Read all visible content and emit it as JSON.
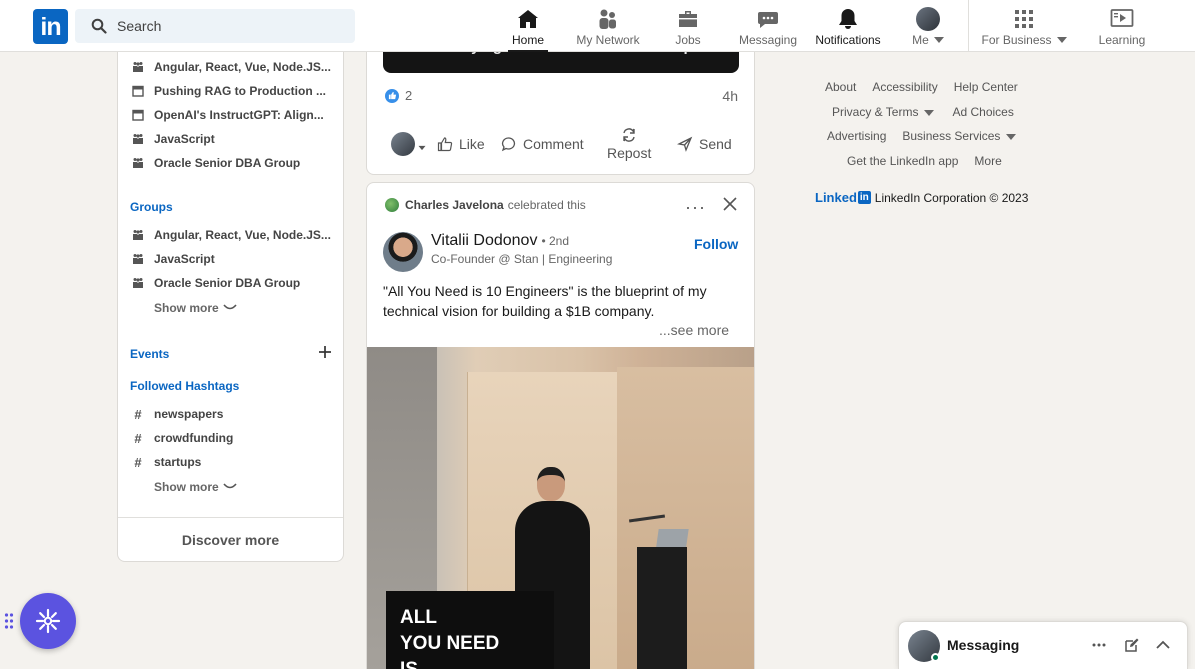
{
  "nav": {
    "logo_text": "in",
    "search_placeholder": "Search",
    "items": [
      {
        "label": "Home",
        "icon": "home-icon"
      },
      {
        "label": "My Network",
        "icon": "network-icon"
      },
      {
        "label": "Jobs",
        "icon": "briefcase-icon"
      },
      {
        "label": "Messaging",
        "icon": "chat-icon"
      },
      {
        "label": "Notifications",
        "icon": "bell-icon"
      },
      {
        "label": "Me",
        "icon": "avatar"
      },
      {
        "label": "For Business",
        "icon": "grid-icon"
      },
      {
        "label": "Learning",
        "icon": "play-icon"
      }
    ]
  },
  "sidebar": {
    "recent": [
      {
        "label": "Angular, React, Vue, Node.JS...",
        "icon": "group-icon"
      },
      {
        "label": "Pushing RAG to Production ...",
        "icon": "calendar-icon"
      },
      {
        "label": "OpenAI's InstructGPT: Align...",
        "icon": "calendar-icon"
      },
      {
        "label": "JavaScript",
        "icon": "group-icon"
      },
      {
        "label": "Oracle Senior DBA Group",
        "icon": "group-icon"
      }
    ],
    "groups_title": "Groups",
    "groups": [
      {
        "label": "Angular, React, Vue, Node.JS..."
      },
      {
        "label": "JavaScript"
      },
      {
        "label": "Oracle Senior DBA Group"
      }
    ],
    "show_more": "Show more",
    "events_title": "Events",
    "hashtags_title": "Followed Hashtags",
    "hashtags": [
      {
        "label": "newspapers"
      },
      {
        "label": "crowdfunding"
      },
      {
        "label": "startups"
      }
    ],
    "discover_more": "Discover more"
  },
  "post1": {
    "image_caption": "the Underlying Issues in Tech Leadership",
    "reaction_count": "2",
    "age": "4h",
    "actions": {
      "like": "Like",
      "comment": "Comment",
      "repost": "Repost",
      "send": "Send"
    }
  },
  "post2": {
    "celebrator": "Charles Javelona",
    "celebrated_text": "celebrated this",
    "author_name": "Vitalii Dodonov",
    "degree": "• 2nd",
    "author_headline": "Co-Founder @ Stan | Engineering",
    "follow_label": "Follow",
    "text": "\"All You Need is 10 Engineers\" is the blueprint of my technical vision for building a $1B company.",
    "see_more": "...see more",
    "image_overlay_text": "ALL\nYOU NEED\nIS"
  },
  "footer": {
    "links": [
      "About",
      "Accessibility",
      "Help Center",
      "Privacy & Terms",
      "Ad Choices",
      "Advertising",
      "Business Services",
      "Get the LinkedIn app",
      "More"
    ],
    "brand_word": "Linked",
    "brand_box": "in",
    "copyright": "LinkedIn Corporation © 2023"
  },
  "messaging_bar": {
    "title": "Messaging"
  },
  "colors": {
    "brand": "#0a66c2",
    "background": "#f4f2ee",
    "fab": "#5b53e0",
    "online": "#01754f"
  }
}
